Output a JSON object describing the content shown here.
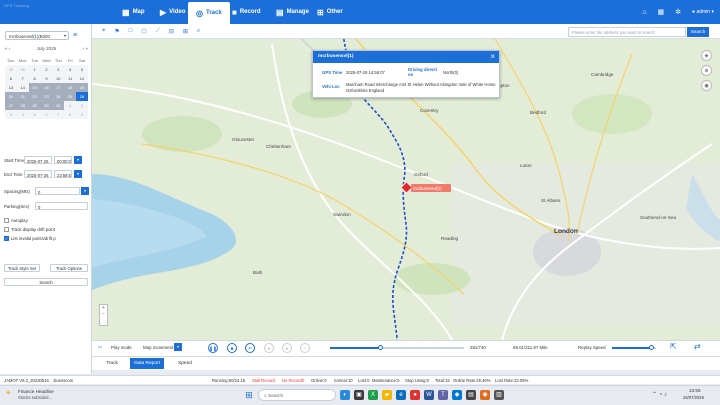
{
  "app": {
    "logo_text": "GPS Tracking"
  },
  "nav": [
    {
      "label": "Map",
      "icon": "map-icon"
    },
    {
      "label": "Video",
      "icon": "video-icon"
    },
    {
      "label": "Track",
      "icon": "track-icon"
    },
    {
      "label": "Record",
      "icon": "record-icon"
    },
    {
      "label": "Manage",
      "icon": "manage-icon"
    },
    {
      "label": "Other",
      "icon": "other-icon"
    }
  ],
  "user": {
    "name": "admin"
  },
  "sidebar": {
    "vehicle_select": "mcrbusensvl(1)(B200",
    "calendar": {
      "month_label": "July 2025",
      "weekdays": [
        "Sun",
        "Mon",
        "Tue",
        "Wed",
        "Thu",
        "Fri",
        "Sat"
      ],
      "rows": [
        [
          "29",
          "30",
          "1",
          "2",
          "3",
          "4",
          "5"
        ],
        [
          "6",
          "7",
          "8",
          "9",
          "10",
          "11",
          "12"
        ],
        [
          "13",
          "14",
          "15",
          "16",
          "17",
          "18",
          "19"
        ],
        [
          "20",
          "21",
          "22",
          "23",
          "24",
          "25",
          "26"
        ],
        [
          "27",
          "28",
          "29",
          "30",
          "31",
          "1",
          "2"
        ],
        [
          "3",
          "4",
          "5",
          "6",
          "7",
          "8",
          "9"
        ]
      ]
    },
    "start_label": "Start Time",
    "start_date": "2025-07-26",
    "start_time": "00:00:00",
    "end_label": "End Time",
    "end_date": "2025-07-26",
    "end_time": "23:59:59",
    "spacing_label": "Spacing(Mts)",
    "spacing_value": "0",
    "parking_label": "Parking(Sec)",
    "parking_value": "0",
    "autoplay_label": "Autoplay",
    "drift_label": "Track display drift point",
    "invalid_label": "List invalid points/drift p",
    "track_style_btn": "Track Style Set",
    "track_options_btn": "Track Options",
    "search_btn": "Search"
  },
  "map": {
    "search_placeholder": "Please enter the address you want to search",
    "search_button": "Search",
    "popup": {
      "title": "mcrbusensvl(1)",
      "gps_time_label": "GPS Time",
      "gps_time": "2025-07-26 14:56:07",
      "direction_label": "Driving directi on",
      "direction": "North(0)",
      "location_label": "Vehi Loc",
      "location": "Marcham Road Interchange A34 St Helen Without Abingdon Vale of White Horse Oxfordshire England"
    },
    "vehicle_label": "mcrbusensvl(1)",
    "labels": {
      "london": "London",
      "cheltenham": "Cheltenham",
      "gloucester": "Gloucester",
      "swindon": "Swindon",
      "reading": "Reading",
      "oxford": "Oxford",
      "cambridge": "Cambridge",
      "northampton": "Northampton",
      "bath": "Bath",
      "luton": "Luton",
      "southend": "Southend-on-Sea",
      "st_albans": "St Albans",
      "bedford": "Bedford",
      "coventry": "Coventry"
    }
  },
  "playback": {
    "play_mode": "Play mode",
    "map_movement": "Map movement",
    "progress_count": "281/740",
    "distance": "69.01/211.97 Mile",
    "replay_speed": "Replay Speed",
    "progress_fraction": 0.38,
    "speed_fraction": 0.9
  },
  "tabs": [
    {
      "label": "Track"
    },
    {
      "label": "Data Report"
    },
    {
      "label": "Speed"
    }
  ],
  "status": {
    "version": "JAMOT V5.2_20230516",
    "user_line": "1luenscom",
    "running": "Running:60/24.16",
    "dep": "Stall Record",
    "no_record": "No Record0",
    "online": "Online:0",
    "normal": "normal:10",
    "lost": "Lost:0",
    "maintenance": "Maintenance:0",
    "stop": "Stop Using:0",
    "total": "Total:15",
    "online_rate": "Online Rate:26.46%",
    "lost_rate": "Lost Rate:23.09%"
  },
  "taskbar": {
    "news_title": "Finance Headline",
    "news_sub": "Stocks subsided...",
    "search_placeholder": "Search",
    "time": "13:56",
    "date": "26/07/2025"
  }
}
